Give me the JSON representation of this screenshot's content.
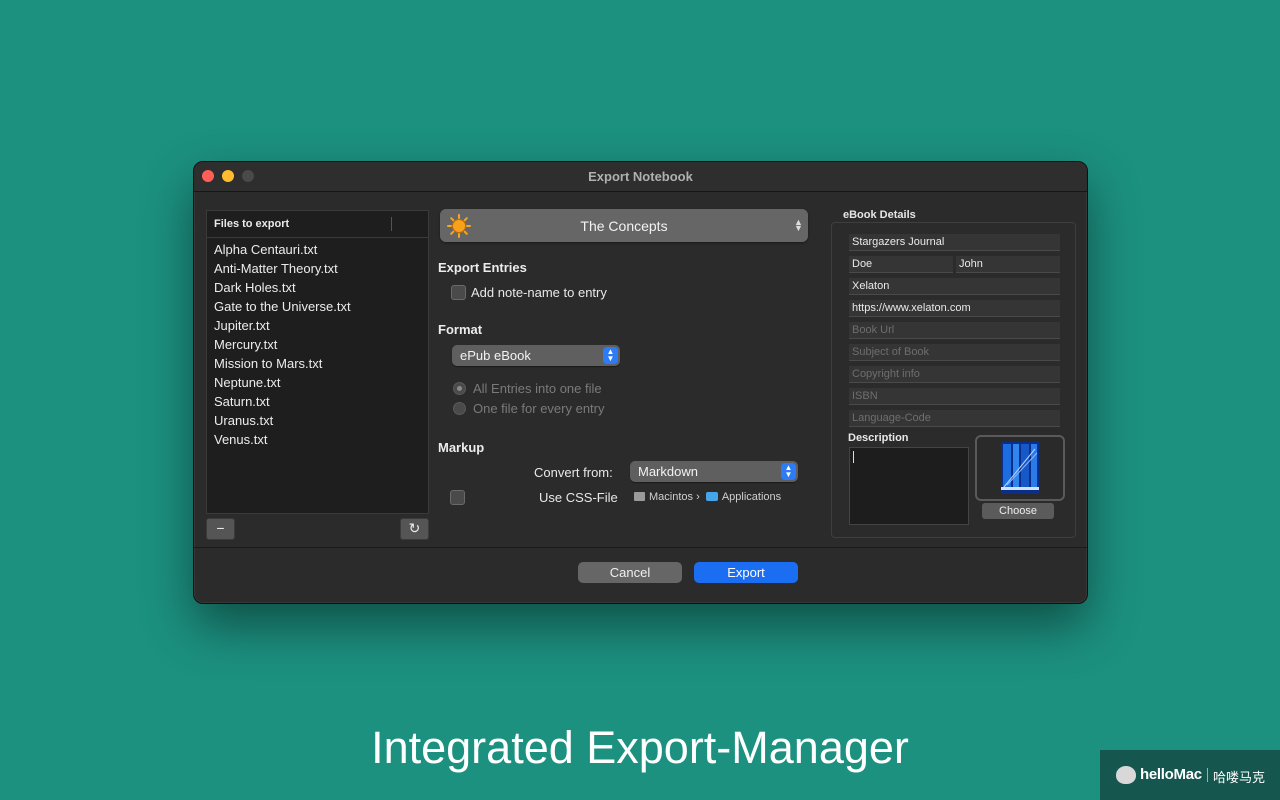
{
  "window": {
    "title": "Export Notebook"
  },
  "files": {
    "header": "Files to export",
    "items": [
      "Alpha Centauri.txt",
      "Anti-Matter Theory.txt",
      "Dark Holes.txt",
      "Gate to the Universe.txt",
      "Jupiter.txt",
      "Mercury.txt",
      "Mission to Mars.txt",
      "Neptune.txt",
      "Saturn.txt",
      "Uranus.txt",
      "Venus.txt"
    ],
    "remove_label": "−",
    "refresh_label": "↻"
  },
  "notebook": {
    "selected": "The Concepts",
    "icon": "sun-icon"
  },
  "export_entries": {
    "title": "Export Entries",
    "add_note_name_label": "Add note-name to entry",
    "add_note_name_checked": false
  },
  "format": {
    "title": "Format",
    "selected": "ePub eBook",
    "option_one_file": "All Entries into one file",
    "option_every_entry": "One file for every entry",
    "selected_option": "All Entries into one file"
  },
  "markup": {
    "title": "Markup",
    "convert_from_label": "Convert from:",
    "convert_from_value": "Markdown",
    "use_css_label": "Use CSS-File",
    "use_css_checked": false,
    "path_drive": "Macintos",
    "path_sep": "›",
    "path_folder": "Applications"
  },
  "ebook": {
    "section_title": "eBook Details",
    "title_value": "Stargazers Journal",
    "last_name": "Doe",
    "first_name": "John",
    "publisher": "Xelaton",
    "website": "https://www.xelaton.com",
    "book_url_placeholder": "Book Url",
    "subject_placeholder": "Subject of Book",
    "copyright_placeholder": "Copyright info",
    "isbn_placeholder": "ISBN",
    "language_placeholder": "Language-Code",
    "description_label": "Description",
    "description_value": "",
    "choose_label": "Choose"
  },
  "footer": {
    "cancel_label": "Cancel",
    "export_label": "Export"
  },
  "caption": "Integrated Export-Manager",
  "watermark": {
    "name": "helloMac",
    "chinese": "哈喽马克"
  },
  "colors": {
    "background": "#1c9180",
    "accent": "#1b6ef2",
    "window": "#2b2b2b"
  }
}
